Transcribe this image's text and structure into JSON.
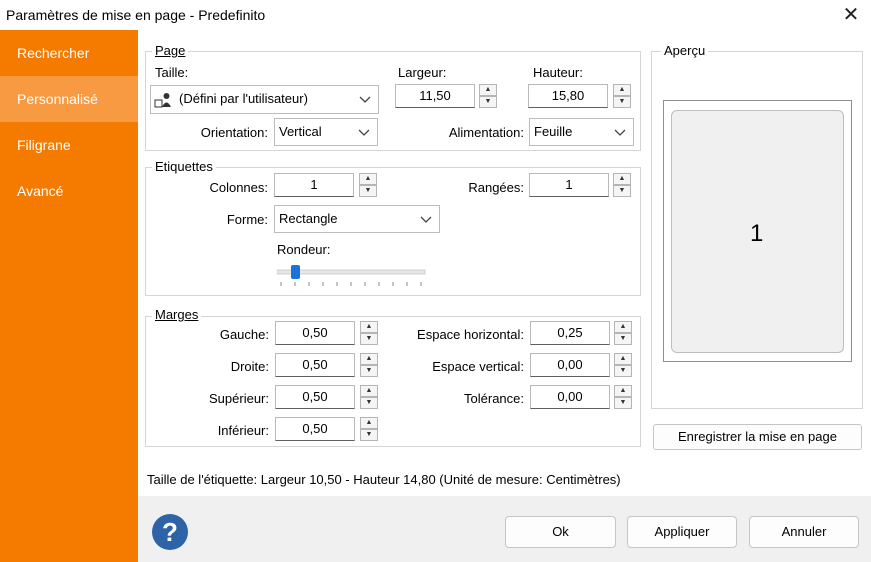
{
  "window": {
    "title": "Paramètres de mise en page - Predefinito",
    "close_glyph": "✕"
  },
  "sidebar": {
    "items": [
      {
        "label": "Rechercher"
      },
      {
        "label": "Personnalisé"
      },
      {
        "label": "Filigrane"
      },
      {
        "label": "Avancé"
      }
    ],
    "active": "Personnalisé"
  },
  "page_group": {
    "legend": "Page",
    "taille_label": "Taille:",
    "taille_value": "(Défini par l'utilisateur)",
    "largeur_label": "Largeur:",
    "largeur_value": "11,50",
    "hauteur_label": "Hauteur:",
    "hauteur_value": "15,80",
    "orientation_label": "Orientation:",
    "orientation_value": "Vertical",
    "alimentation_label": "Alimentation:",
    "alimentation_value": "Feuille"
  },
  "etiquettes_group": {
    "legend": "Etiquettes",
    "colonnes_label": "Colonnes:",
    "colonnes_value": "1",
    "rangees_label": "Rangées:",
    "rangees_value": "1",
    "forme_label": "Forme:",
    "forme_value": "Rectangle",
    "rondeur_label": "Rondeur:",
    "rondeur_level": 0.1
  },
  "marges_group": {
    "legend": "Marges",
    "gauche_label": "Gauche:",
    "gauche_value": "0,50",
    "droite_label": "Droite:",
    "droite_value": "0,50",
    "superieur_label": "Supérieur:",
    "superieur_value": "0,50",
    "inferieur_label": "Inférieur:",
    "inferieur_value": "0,50",
    "espace_h_label": "Espace horizontal:",
    "espace_h_value": "0,25",
    "espace_v_label": "Espace vertical:",
    "espace_v_value": "0,00",
    "tolerance_label": "Tolérance:",
    "tolerance_value": "0,00"
  },
  "apercu": {
    "legend": "Aperçu",
    "page_number": "1"
  },
  "save_layout_button": "Enregistrer la mise en page",
  "status_text": "Taille de l'étiquette: Largeur 10,50 - Hauteur 14,80 (Unité de mesure: Centimètres)",
  "buttons": {
    "ok": "Ok",
    "apply": "Appliquer",
    "cancel": "Annuler"
  },
  "help_glyph": "?",
  "colors": {
    "sidebar": "#f47a00",
    "sidebar_active": "#f79a42",
    "help": "#2e63a8",
    "slider_thumb": "#1a73d9"
  }
}
